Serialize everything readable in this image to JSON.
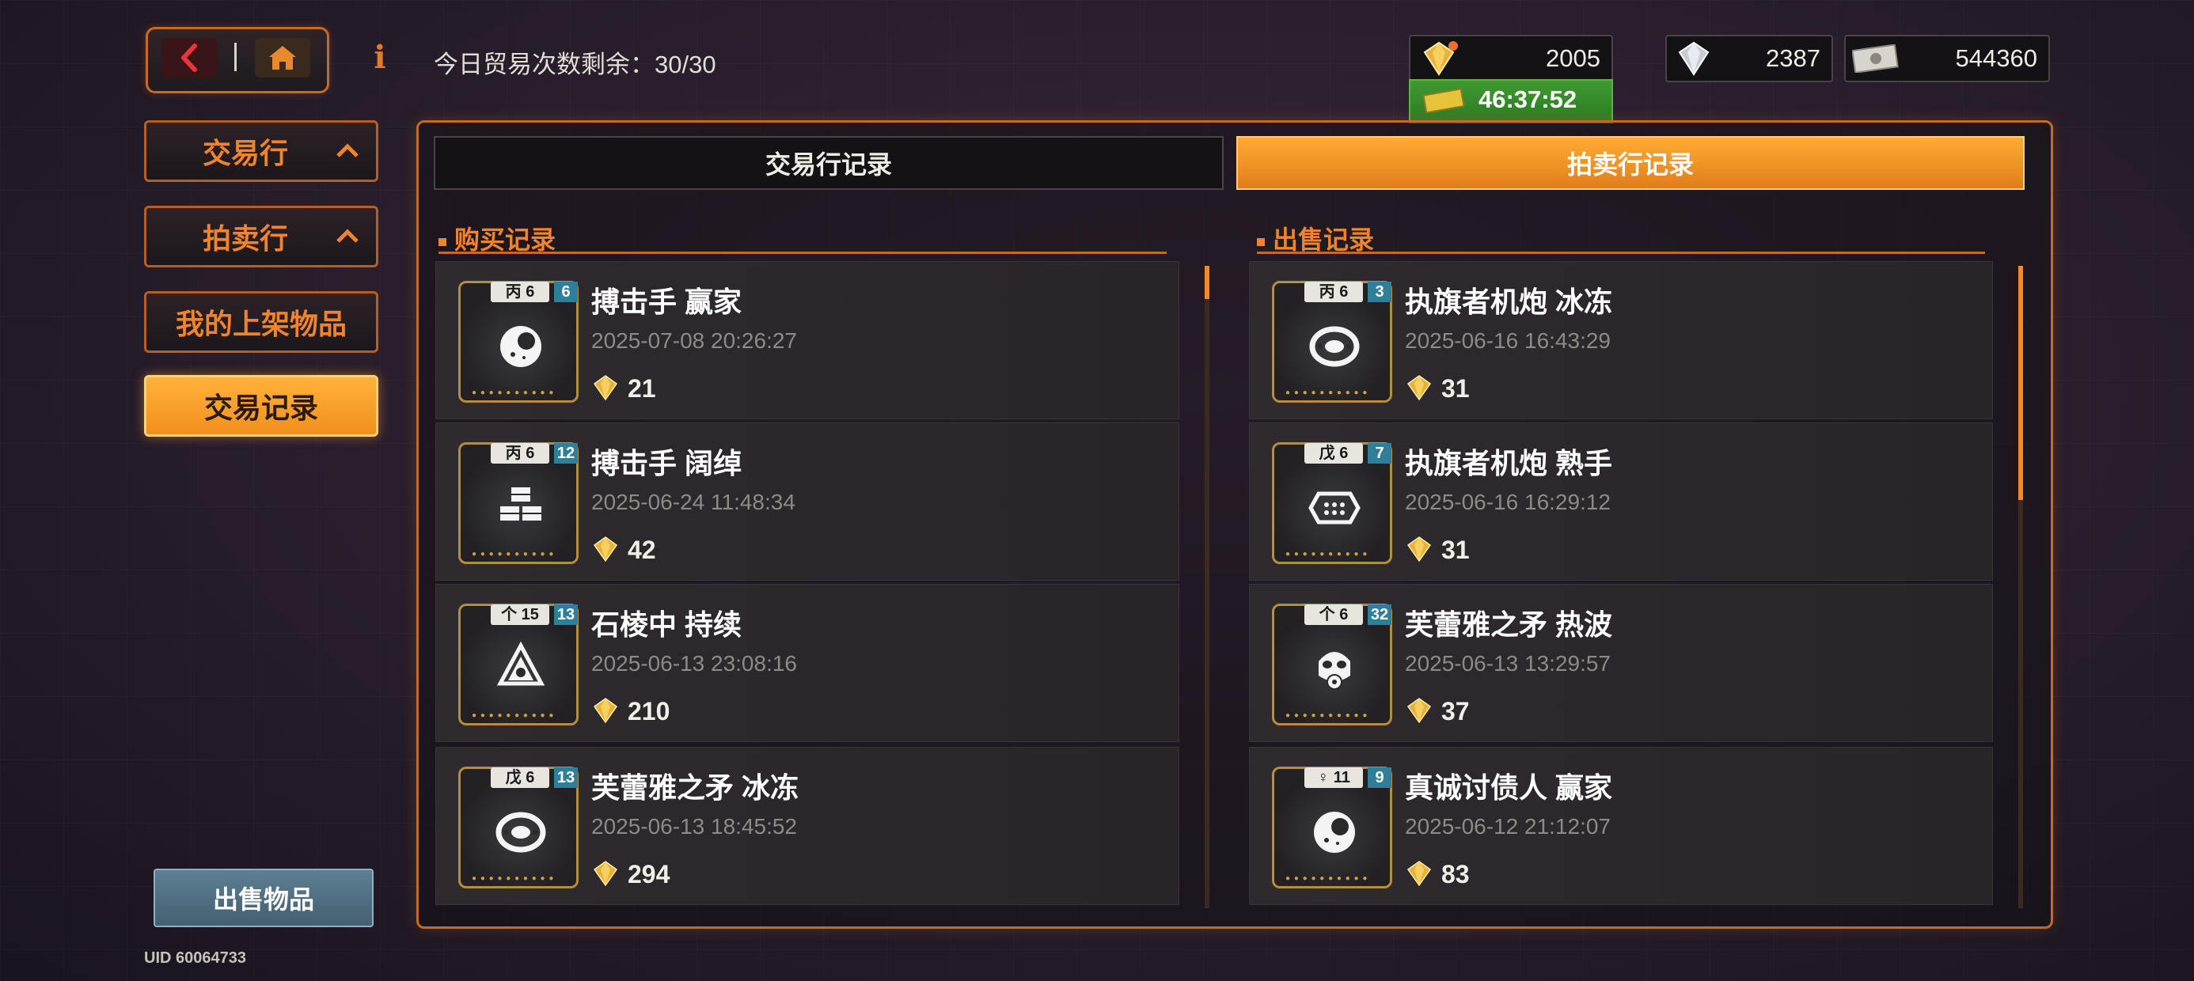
{
  "header": {
    "trade_remaining": "今日贸易次数剩余：30/30"
  },
  "currencies": [
    {
      "icon": "gold-gem-icon",
      "value": "2005"
    },
    {
      "icon": "silver-gem-icon",
      "value": "2387"
    },
    {
      "icon": "banknote-icon",
      "value": "544360"
    }
  ],
  "timer": {
    "icon": "ticket-icon",
    "value": "46:37:52"
  },
  "sidebar": {
    "items": [
      {
        "label": "交易行"
      },
      {
        "label": "拍卖行"
      },
      {
        "label": "我的上架物品"
      },
      {
        "label": "交易记录"
      }
    ],
    "sell_button": "出售物品",
    "uid": "UID 60064733"
  },
  "tabs": [
    {
      "label": "交易行记录"
    },
    {
      "label": "拍卖行记录"
    }
  ],
  "buy_records": {
    "title": "购买记录",
    "items": [
      {
        "tag": "丙 6",
        "num": "6",
        "icon": "moon-sphere-icon",
        "name": "搏击手 赢家",
        "date": "2025-07-08 20:26:27",
        "price": "21"
      },
      {
        "tag": "丙 6",
        "num": "12",
        "icon": "blocks-icon",
        "name": "搏击手 阔绰",
        "date": "2025-06-24 11:48:34",
        "price": "42"
      },
      {
        "tag": "个 15",
        "num": "13",
        "icon": "tri-shield-icon",
        "name": "石棱中 持续",
        "date": "2025-06-13 23:08:16",
        "price": "210"
      },
      {
        "tag": "戊 6",
        "num": "13",
        "icon": "ring-dots-icon",
        "name": "芙蕾雅之矛 冰冻",
        "date": "2025-06-13 18:45:52",
        "price": "294"
      }
    ]
  },
  "sell_records": {
    "title": "出售记录",
    "items": [
      {
        "tag": "丙 6",
        "num": "3",
        "icon": "ring-dots-icon",
        "name": "执旗者机炮 冰冻",
        "date": "2025-06-16 16:43:29",
        "price": "31"
      },
      {
        "tag": "戊 6",
        "num": "7",
        "icon": "hex-grid-icon",
        "name": "执旗者机炮 熟手",
        "date": "2025-06-16 16:29:12",
        "price": "31"
      },
      {
        "tag": "个 6",
        "num": "32",
        "icon": "skull-mask-icon",
        "name": "芙蕾雅之矛 热波",
        "date": "2025-06-13 13:29:57",
        "price": "37"
      },
      {
        "tag": "♀ 11",
        "num": "9",
        "icon": "moon-sphere-icon",
        "name": "真诚讨债人 赢家",
        "date": "2025-06-12 21:12:07",
        "price": "83"
      }
    ]
  },
  "colors": {
    "accent": "#f0842c",
    "active": "#f59a24",
    "green": "#3f9a32"
  }
}
